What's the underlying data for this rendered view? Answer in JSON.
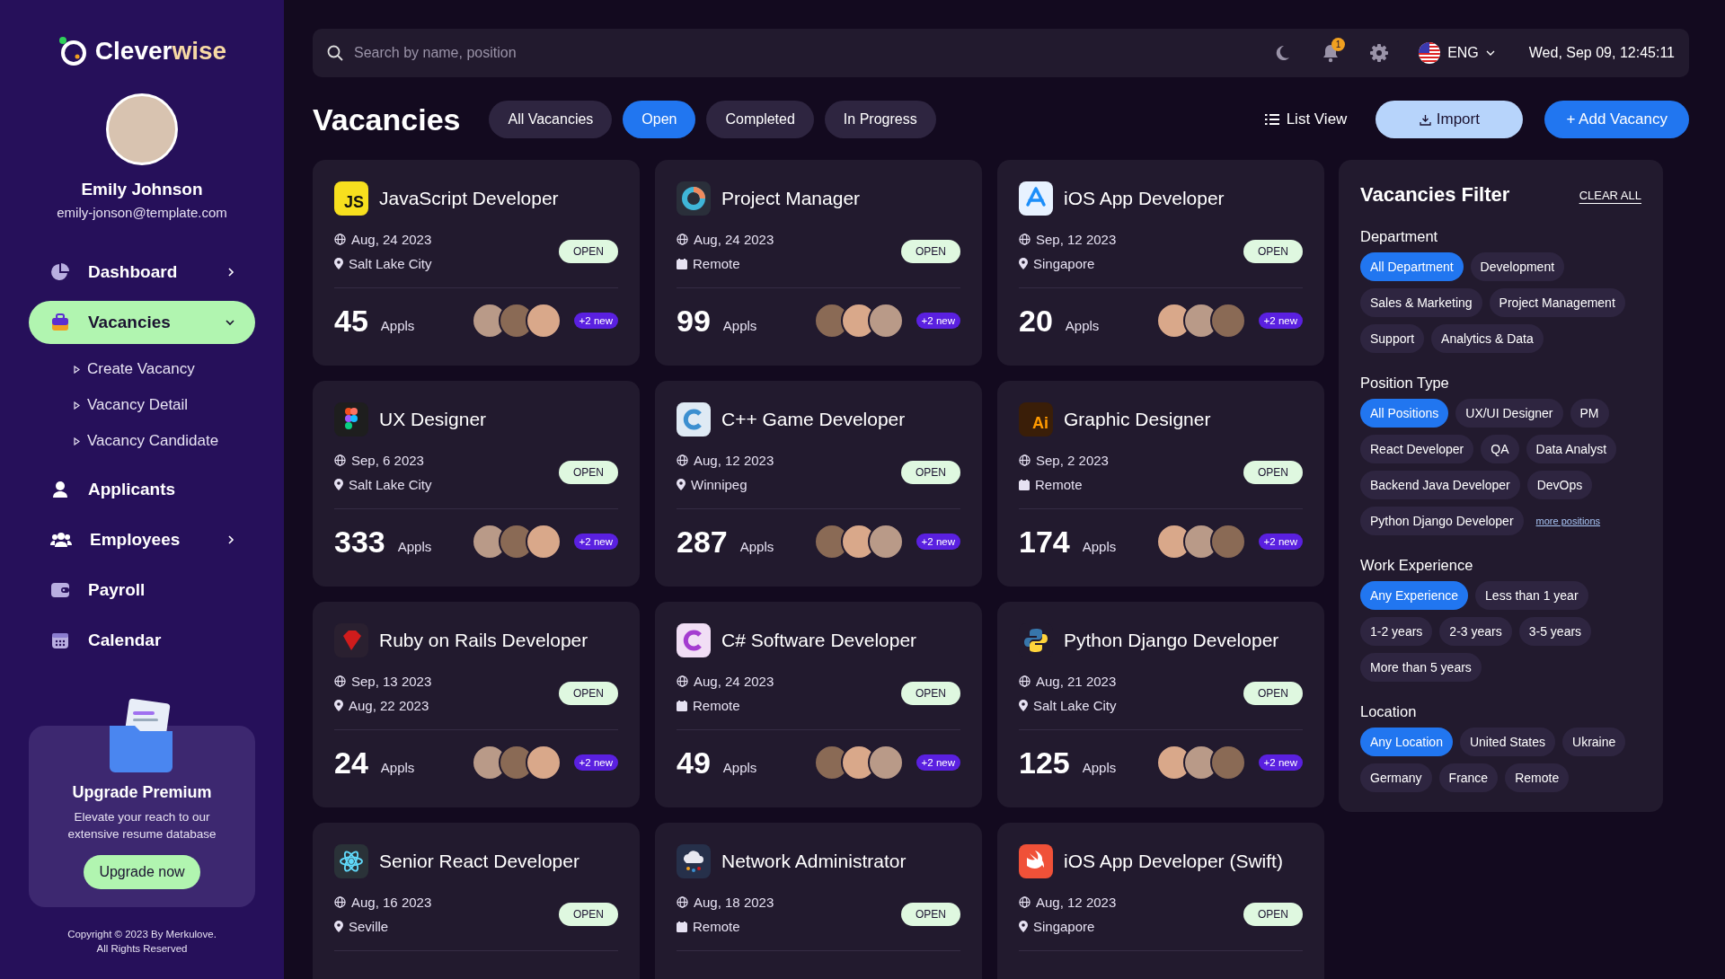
{
  "brand": {
    "name_a": "Clever",
    "name_b": "wise"
  },
  "user": {
    "name": "Emily Johnson",
    "email": "emily-jonson@template.com"
  },
  "nav": [
    {
      "label": "Dashboard",
      "selected": false,
      "expandable": true,
      "expanded": false
    },
    {
      "label": "Vacancies",
      "selected": true,
      "expandable": true,
      "expanded": true,
      "children": [
        {
          "label": "Create Vacancy"
        },
        {
          "label": "Vacancy Detail"
        },
        {
          "label": "Vacancy Candidate"
        }
      ]
    },
    {
      "label": "Applicants",
      "selected": false
    },
    {
      "label": "Employees",
      "selected": false,
      "expandable": true,
      "expanded": false
    },
    {
      "label": "Payroll",
      "selected": false
    },
    {
      "label": "Calendar",
      "selected": false
    }
  ],
  "promo": {
    "title": "Upgrade Premium",
    "text": "Elevate your reach to our extensive resume database",
    "button": "Upgrade now"
  },
  "copyright": [
    "Copyright © 2023 By Merkulove.",
    "All Rights Reserved"
  ],
  "topbar": {
    "search_placeholder": "Search by name, position",
    "notifications": "1",
    "language": "ENG",
    "datetime": "Wed, Sep 09, 12:45:11"
  },
  "page": {
    "title": "Vacancies",
    "view": "List View",
    "import": "Import",
    "add": "+ Add Vacancy"
  },
  "tabs": [
    {
      "label": "All Vacancies",
      "selected": false
    },
    {
      "label": "Open",
      "selected": true
    },
    {
      "label": "Completed",
      "selected": false
    },
    {
      "label": "In Progress",
      "selected": false
    }
  ],
  "vacancies": [
    {
      "title": "JavaScript Developer",
      "logo_text": "JS",
      "date": "Aug, 24 2023",
      "place": "Salt Lake City",
      "kind": "onsite",
      "status": "OPEN",
      "apps": "45",
      "apps_label": "Appls",
      "new": "+2 new"
    },
    {
      "title": "Project Manager",
      "date": "Aug, 24 2023",
      "place": "Remote",
      "kind": "remote",
      "status": "OPEN",
      "apps": "99",
      "apps_label": "Appls",
      "new": "+2 new"
    },
    {
      "title": "iOS App Developer",
      "date": "Sep, 12 2023",
      "place": "Singapore",
      "kind": "onsite",
      "status": "OPEN",
      "apps": "20",
      "apps_label": "Appls",
      "new": "+2 new"
    },
    {
      "title": "UX Designer",
      "date": "Sep, 6 2023",
      "place": "Salt Lake City",
      "kind": "onsite",
      "status": "OPEN",
      "apps": "333",
      "apps_label": "Appls",
      "new": "+2 new"
    },
    {
      "title": "C++ Game Developer",
      "date": "Aug, 12 2023",
      "place": "Winnipeg",
      "kind": "onsite",
      "status": "OPEN",
      "apps": "287",
      "apps_label": "Appls",
      "new": "+2 new"
    },
    {
      "title": "Graphic Designer",
      "logo_text": "Ai",
      "date": "Sep, 2 2023",
      "place": "Remote",
      "kind": "remote",
      "status": "OPEN",
      "apps": "174",
      "apps_label": "Appls",
      "new": "+2 new"
    },
    {
      "title": "Ruby on Rails Developer",
      "date": "Sep, 13 2023",
      "place": "Aug, 22 2023",
      "kind": "onsite",
      "status": "OPEN",
      "apps": "24",
      "apps_label": "Appls",
      "new": "+2 new"
    },
    {
      "title": "C# Software Developer",
      "date": "Aug, 24 2023",
      "place": "Remote",
      "kind": "remote",
      "status": "OPEN",
      "apps": "49",
      "apps_label": "Appls",
      "new": "+2 new"
    },
    {
      "title": "Python Django Developer",
      "date": "Aug, 21 2023",
      "place": "Salt Lake City",
      "kind": "onsite",
      "status": "OPEN",
      "apps": "125",
      "apps_label": "Appls",
      "new": "+2 new"
    },
    {
      "title": "Senior React Developer",
      "date": "Aug, 16 2023",
      "place": "Seville",
      "kind": "onsite",
      "status": "OPEN"
    },
    {
      "title": "Network Administrator",
      "date": "Aug, 18 2023",
      "place": "Remote",
      "kind": "remote",
      "status": "OPEN"
    },
    {
      "title": "iOS App Developer (Swift)",
      "date": "Aug, 12 2023",
      "place": "Singapore",
      "kind": "onsite",
      "status": "OPEN"
    }
  ],
  "filter": {
    "title": "Vacancies Filter",
    "clear": "CLEAR ALL",
    "groups": [
      {
        "label": "Department",
        "options": [
          {
            "label": "All Department",
            "selected": true
          },
          {
            "label": "Development",
            "selected": false
          },
          {
            "label": "Sales & Marketing",
            "selected": false
          },
          {
            "label": "Project Management",
            "selected": false
          },
          {
            "label": "Support",
            "selected": false
          },
          {
            "label": "Analytics & Data",
            "selected": false
          }
        ]
      },
      {
        "label": "Position Type",
        "options": [
          {
            "label": "All Positions",
            "selected": true
          },
          {
            "label": "UX/UI Designer",
            "selected": false
          },
          {
            "label": "PM",
            "selected": false
          },
          {
            "label": "React Developer",
            "selected": false
          },
          {
            "label": "QA",
            "selected": false
          },
          {
            "label": "Data Analyst",
            "selected": false
          },
          {
            "label": "Backend Java Developer",
            "selected": false
          },
          {
            "label": "DevOps",
            "selected": false
          },
          {
            "label": "Python Django Developer",
            "selected": false
          }
        ],
        "more_link": "more positions"
      },
      {
        "label": "Work Experience",
        "options": [
          {
            "label": "Any Experience",
            "selected": true
          },
          {
            "label": "Less than 1 year",
            "selected": false
          },
          {
            "label": "1-2 years",
            "selected": false
          },
          {
            "label": "2-3 years",
            "selected": false
          },
          {
            "label": "3-5 years",
            "selected": false
          },
          {
            "label": "More than 5 years",
            "selected": false
          }
        ]
      },
      {
        "label": "Location",
        "options": [
          {
            "label": "Any Location",
            "selected": true
          },
          {
            "label": "United States",
            "selected": false
          },
          {
            "label": "Ukraine",
            "selected": false
          },
          {
            "label": "Germany",
            "selected": false
          },
          {
            "label": "France",
            "selected": false
          },
          {
            "label": "Remote",
            "selected": false
          }
        ]
      }
    ]
  }
}
